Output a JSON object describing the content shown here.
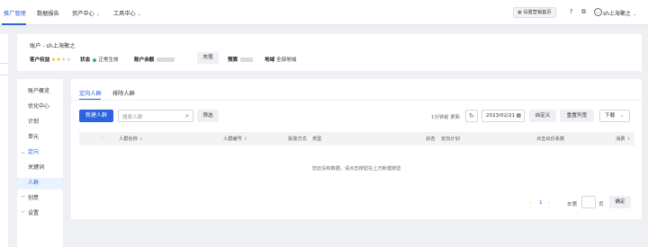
{
  "topnav": {
    "items": [
      {
        "label": "推广管理",
        "active": true,
        "caret": false
      },
      {
        "label": "数据报告",
        "active": false,
        "caret": false
      },
      {
        "label": "资产中心",
        "active": false,
        "caret": true
      },
      {
        "label": "工具中心",
        "active": false,
        "caret": true
      }
    ],
    "fav_label": "设置营销首页",
    "user_name": "sh上海聚之",
    "icons": [
      "help-icon",
      "copy-icon",
      "user-icon",
      "chevron-down-icon"
    ]
  },
  "account": {
    "title": "账户 - sh上海聚之",
    "rights_label": "客户权益",
    "rating": 2.5,
    "status_label": "状态",
    "status_value": "正常生效",
    "balance_label": "账户余额",
    "recharge_label": "充值",
    "budget_label": "预算",
    "region_label": "地域",
    "region_value": "全部地域"
  },
  "sidemenu": {
    "items": [
      {
        "label": "账户概览",
        "kind": "item"
      },
      {
        "label": "优化中心",
        "kind": "item"
      },
      {
        "label": "计划",
        "kind": "item"
      },
      {
        "label": "单元",
        "kind": "item"
      },
      {
        "label": "定向",
        "kind": "group-open"
      },
      {
        "label": "关键词",
        "kind": "item"
      },
      {
        "label": "人群",
        "kind": "item-active"
      },
      {
        "label": "创意",
        "kind": "group-closed"
      },
      {
        "label": "设置",
        "kind": "group-closed"
      }
    ]
  },
  "main": {
    "tabs": [
      "定向人群",
      "排除人群"
    ],
    "new_button": "新建人群",
    "search_placeholder": "搜索人群",
    "filter_button": "筛选",
    "update_text": "1分钟前 更新",
    "date_value": "2023/02/21",
    "custom_button": "自定义",
    "reset_button": "重置列宽",
    "download_button": "下载",
    "columns": [
      "人群名称",
      "人群编号",
      "投放方式",
      "类型",
      "状态",
      "定向计划",
      "点击出价系数",
      "消费"
    ],
    "empty_text": "您还没有数据，请点击按钮在上方新建按钮",
    "pager": {
      "current": "1",
      "goto_label": "去第",
      "page_unit": "页",
      "confirm": "确定"
    }
  }
}
